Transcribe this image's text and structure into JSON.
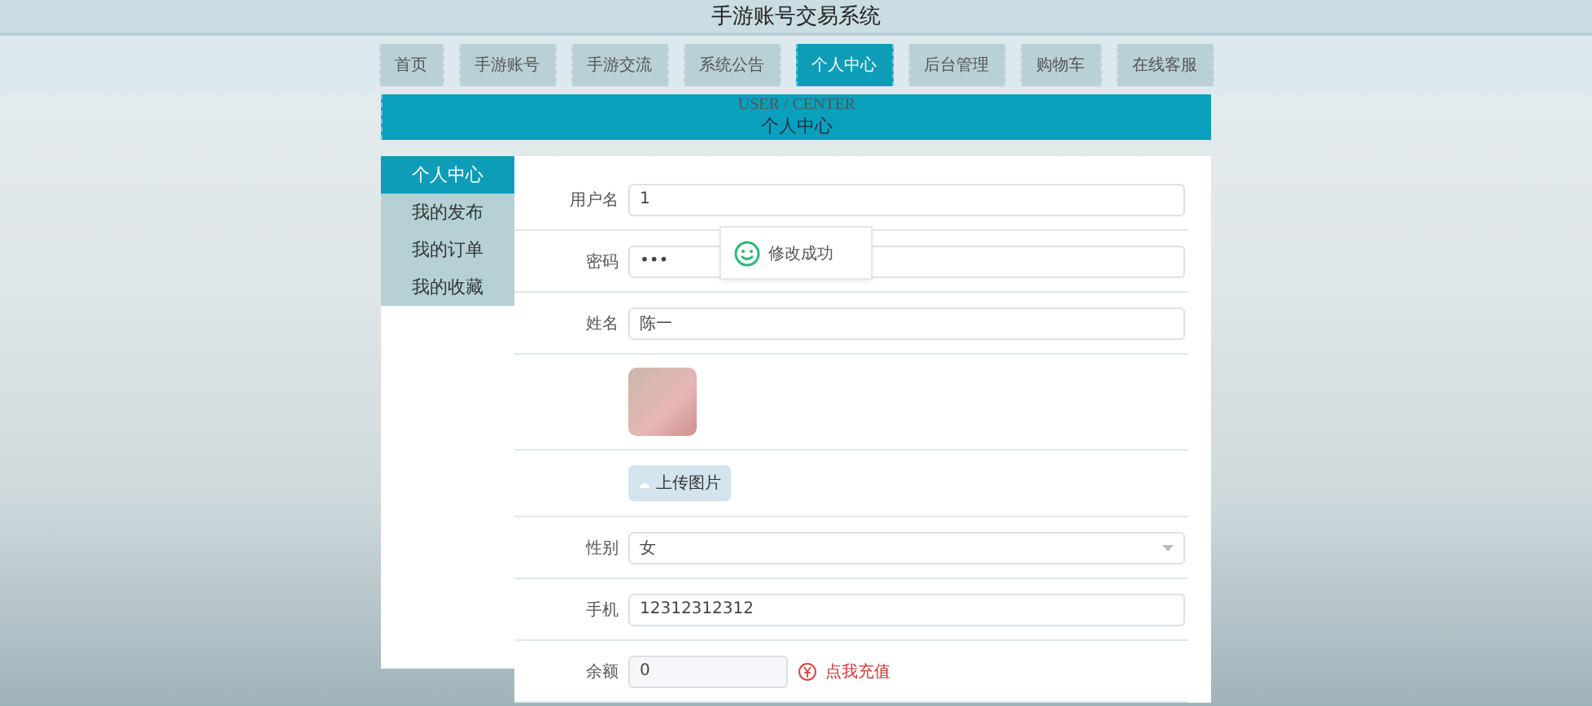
{
  "site_title": "手游账号交易系统",
  "nav": [
    {
      "label": "首页",
      "selected": false
    },
    {
      "label": "手游账号",
      "selected": false
    },
    {
      "label": "手游交流",
      "selected": false
    },
    {
      "label": "系统公告",
      "selected": false
    },
    {
      "label": "个人中心",
      "selected": true
    },
    {
      "label": "后台管理",
      "selected": false
    },
    {
      "label": "购物车",
      "selected": false
    },
    {
      "label": "在线客服",
      "selected": false
    }
  ],
  "banner": {
    "subtitle": "USER / CENTER",
    "title": "个人中心"
  },
  "sidebar": {
    "items": [
      {
        "label": "个人中心",
        "selected": true
      },
      {
        "label": "我的发布",
        "selected": false
      },
      {
        "label": "我的订单",
        "selected": false
      },
      {
        "label": "我的收藏",
        "selected": false
      }
    ]
  },
  "form": {
    "rows": [
      {
        "kind": "text",
        "label": "用户名",
        "value": "1"
      },
      {
        "kind": "password",
        "label": "密码",
        "value": "•••"
      },
      {
        "kind": "text",
        "label": "姓名",
        "value": "陈一"
      },
      {
        "kind": "image"
      },
      {
        "kind": "upload",
        "button": "上传图片"
      },
      {
        "kind": "select",
        "label": "性别",
        "value": "女"
      },
      {
        "kind": "text",
        "label": "手机",
        "value": "12312312312"
      },
      {
        "kind": "recharge",
        "label": "余额",
        "value": "0",
        "link": "点我充值"
      }
    ]
  },
  "toast": {
    "message": "修改成功"
  }
}
